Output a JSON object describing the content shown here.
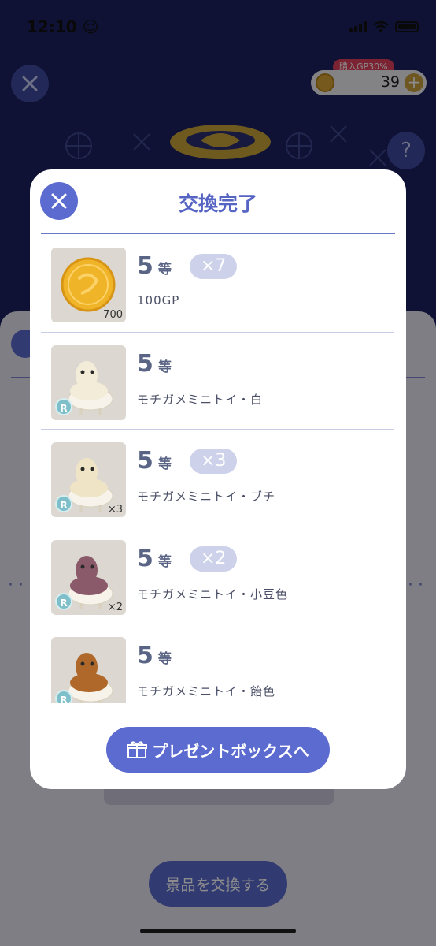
{
  "status_bar": {
    "time": "12:10",
    "time_icon": "smiley-icon"
  },
  "background": {
    "gp_badge": "購入GP30%",
    "gp_value": "39",
    "help_label": "?",
    "exchange_button_label": "景品を交換する"
  },
  "modal": {
    "title": "交換完了",
    "items": [
      {
        "grade": "5",
        "unit": "等",
        "qty": "×7",
        "name": "100GP",
        "thumb_type": "coin",
        "thumb_label": "700",
        "rank": ""
      },
      {
        "grade": "5",
        "unit": "等",
        "qty": "",
        "name": "モチガメミニトイ・白",
        "thumb_type": "toy",
        "thumb_label": "",
        "rank": "R"
      },
      {
        "grade": "5",
        "unit": "等",
        "qty": "×3",
        "name": "モチガメミニトイ・ブチ",
        "thumb_type": "toy",
        "thumb_label": "×3",
        "rank": "R"
      },
      {
        "grade": "5",
        "unit": "等",
        "qty": "×2",
        "name": "モチガメミニトイ・小豆色",
        "thumb_type": "toy",
        "thumb_label": "×2",
        "rank": "R"
      },
      {
        "grade": "5",
        "unit": "等",
        "qty": "",
        "name": "モチガメミニトイ・飴色",
        "thumb_type": "toy",
        "thumb_label": "",
        "rank": "R"
      }
    ],
    "present_button_label": "プレゼントボックスへ"
  },
  "colors": {
    "accent": "#5b6bd0",
    "title": "#5664c4",
    "background_dark": "#1d2160"
  }
}
